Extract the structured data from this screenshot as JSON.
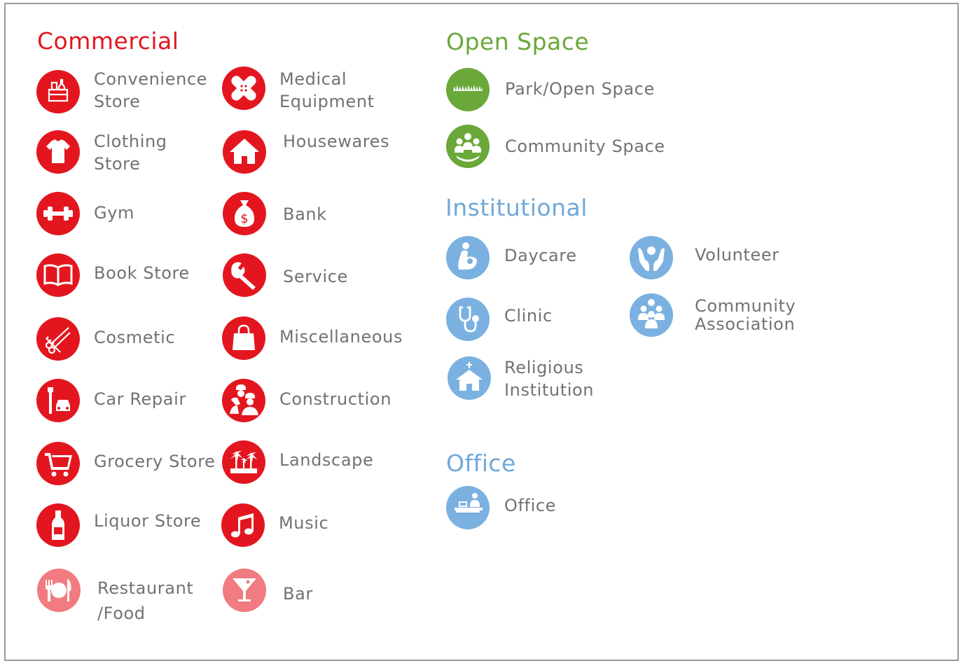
{
  "sections": {
    "commercial": {
      "title": "Commercial",
      "items": [
        {
          "l1": "Convenience",
          "l2": "Store",
          "icon": "shop-bag-icon"
        },
        {
          "l1": "Clothing",
          "l2": "Store",
          "icon": "tshirt-icon"
        },
        {
          "l1": "Gym",
          "icon": "dumbbell-icon"
        },
        {
          "l1": "Book Store",
          "icon": "book-icon"
        },
        {
          "l1": "Cosmetic",
          "icon": "scissors-comb-icon"
        },
        {
          "l1": "Car Repair",
          "icon": "car-wrench-icon"
        },
        {
          "l1": "Grocery Store",
          "icon": "cart-icon"
        },
        {
          "l1": "Liquor Store",
          "icon": "bottle-icon"
        },
        {
          "l1": "Restaurant",
          "l2": "/Food",
          "icon": "plate-cutlery-icon"
        },
        {
          "l1": "Medical",
          "l2": "Equipment",
          "icon": "bandage-icon"
        },
        {
          "l1": "Housewares",
          "icon": "house-icon"
        },
        {
          "l1": "Bank",
          "icon": "money-bag-icon"
        },
        {
          "l1": "Service",
          "icon": "wrench-icon"
        },
        {
          "l1": "Miscellaneous",
          "icon": "shopping-bag-icon"
        },
        {
          "l1": "Construction",
          "icon": "workers-icon"
        },
        {
          "l1": "Landscape",
          "icon": "palm-trees-icon"
        },
        {
          "l1": "Music",
          "icon": "music-note-icon"
        },
        {
          "l1": "Bar",
          "icon": "cocktail-icon"
        }
      ]
    },
    "open_space": {
      "title": "Open Space",
      "items": [
        {
          "l1": "Park/Open Space",
          "icon": "grass-icon"
        },
        {
          "l1": "Community Space",
          "icon": "people-circle-icon"
        }
      ]
    },
    "institutional": {
      "title": "Institutional",
      "items": [
        {
          "l1": "Daycare",
          "icon": "mother-child-icon"
        },
        {
          "l1": "Clinic",
          "icon": "stethoscope-icon"
        },
        {
          "l1": "Religious",
          "l2": "Institution",
          "icon": "church-icon"
        },
        {
          "l1": "Volunteer",
          "icon": "hands-person-icon"
        },
        {
          "l1": "Community",
          "l2": "Association",
          "icon": "people-group-icon"
        }
      ]
    },
    "office": {
      "title": "Office",
      "items": [
        {
          "l1": "Office",
          "icon": "desk-person-icon"
        }
      ]
    }
  },
  "colors": {
    "commercial": "#e3161f",
    "commercial_light": "#f07b80",
    "open_space": "#6aa839",
    "institutional": "#7ab1e0",
    "label": "#727272",
    "frame": "#9a9a9a"
  }
}
